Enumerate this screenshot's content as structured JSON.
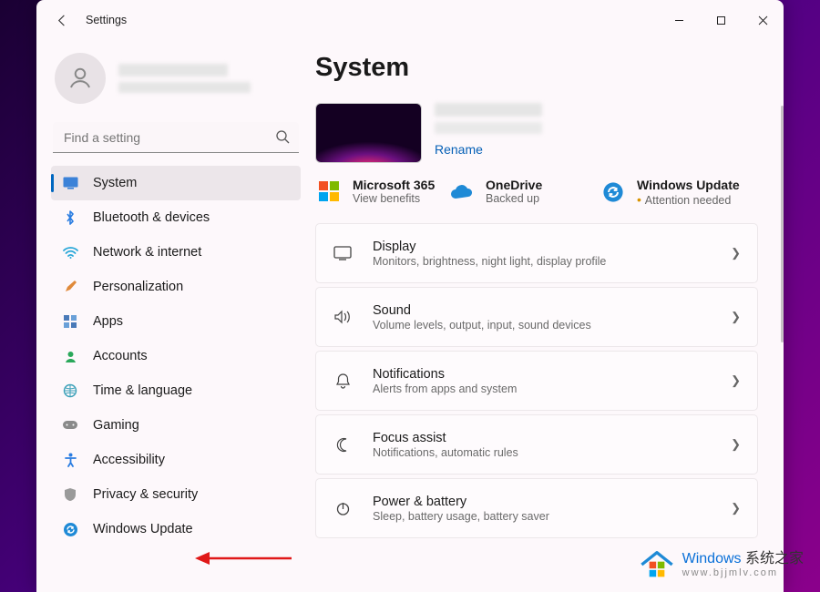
{
  "window": {
    "title": "Settings"
  },
  "search": {
    "placeholder": "Find a setting"
  },
  "sidebar": {
    "items": [
      {
        "label": "System"
      },
      {
        "label": "Bluetooth & devices"
      },
      {
        "label": "Network & internet"
      },
      {
        "label": "Personalization"
      },
      {
        "label": "Apps"
      },
      {
        "label": "Accounts"
      },
      {
        "label": "Time & language"
      },
      {
        "label": "Gaming"
      },
      {
        "label": "Accessibility"
      },
      {
        "label": "Privacy & security"
      },
      {
        "label": "Windows Update"
      }
    ]
  },
  "main": {
    "heading": "System",
    "rename": "Rename",
    "services": [
      {
        "title": "Microsoft 365",
        "sub": "View benefits"
      },
      {
        "title": "OneDrive",
        "sub": "Backed up"
      },
      {
        "title": "Windows Update",
        "sub": "Attention needed"
      }
    ],
    "cards": [
      {
        "title": "Display",
        "sub": "Monitors, brightness, night light, display profile"
      },
      {
        "title": "Sound",
        "sub": "Volume levels, output, input, sound devices"
      },
      {
        "title": "Notifications",
        "sub": "Alerts from apps and system"
      },
      {
        "title": "Focus assist",
        "sub": "Notifications, automatic rules"
      },
      {
        "title": "Power & battery",
        "sub": "Sleep, battery usage, battery saver"
      }
    ]
  },
  "watermark": {
    "brand": "Windows",
    "cn": "系统之家",
    "url": "www.bjjmlv.com"
  }
}
